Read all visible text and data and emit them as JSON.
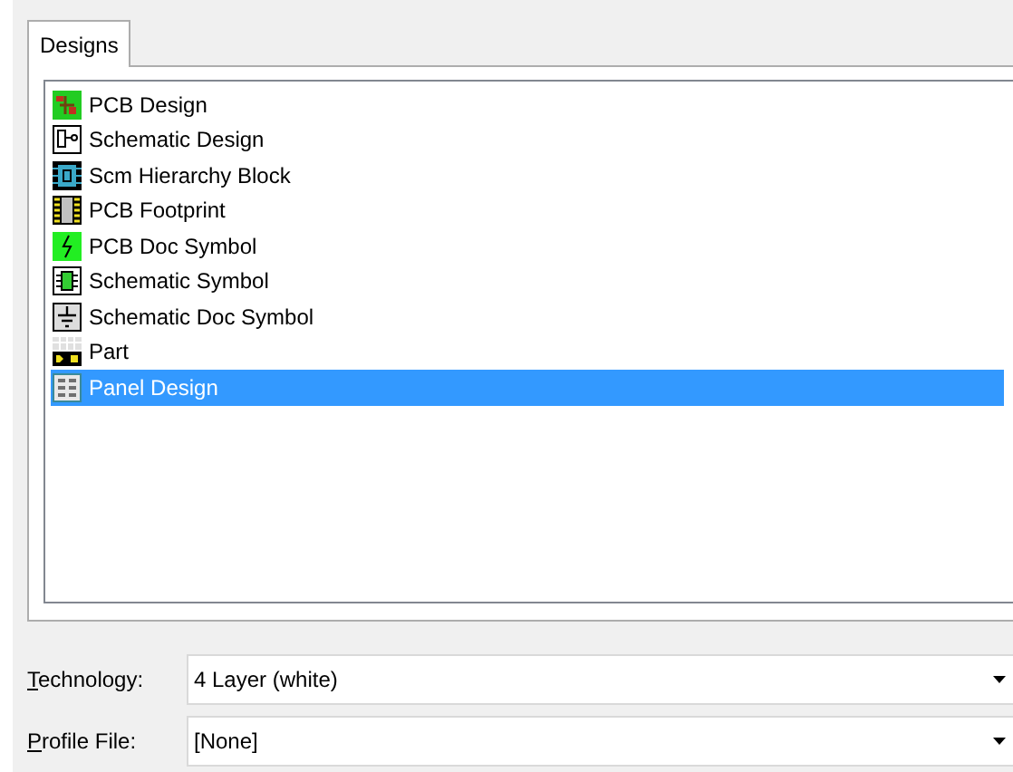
{
  "tabs": [
    {
      "label": "Designs",
      "selected": true
    }
  ],
  "designs": [
    {
      "label": "PCB Design",
      "kind": "pcb",
      "selected": false
    },
    {
      "label": "Schematic Design",
      "kind": "schematic",
      "selected": false
    },
    {
      "label": "Scm Hierarchy Block",
      "kind": "hierarchy",
      "selected": false
    },
    {
      "label": "PCB Footprint",
      "kind": "footprint",
      "selected": false
    },
    {
      "label": "PCB Doc Symbol",
      "kind": "pcbdoc",
      "selected": false
    },
    {
      "label": "Schematic Symbol",
      "kind": "symbol",
      "selected": false
    },
    {
      "label": "Schematic Doc Symbol",
      "kind": "scmdoc",
      "selected": false
    },
    {
      "label": "Part",
      "kind": "part",
      "selected": false
    },
    {
      "label": "Panel Design",
      "kind": "panel",
      "selected": true
    }
  ],
  "fields": [
    {
      "label": "Technology:",
      "mnemonic": true,
      "value": "4 Layer (white)"
    },
    {
      "label": "Profile File:",
      "mnemonic": true,
      "value": "[None]"
    }
  ]
}
